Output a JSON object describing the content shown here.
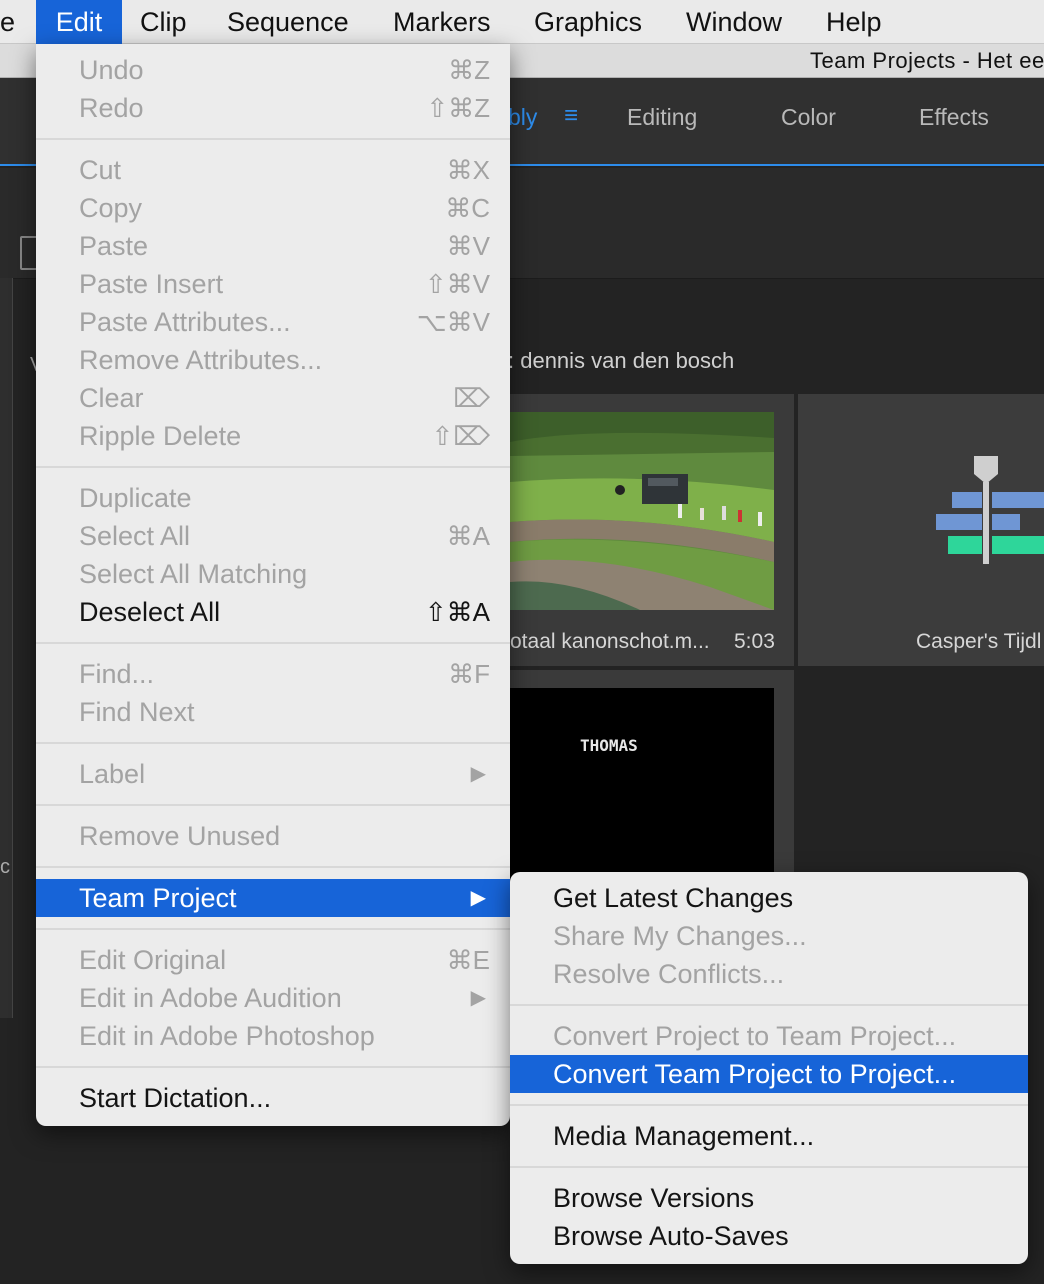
{
  "menubar": {
    "items": [
      {
        "label": "e"
      },
      {
        "label": "Edit"
      },
      {
        "label": "Clip"
      },
      {
        "label": "Sequence"
      },
      {
        "label": "Markers"
      },
      {
        "label": "Graphics"
      },
      {
        "label": "Window"
      },
      {
        "label": "Help"
      }
    ]
  },
  "window": {
    "title": "Team Projects - Het ee"
  },
  "workspaces": {
    "tabs": [
      {
        "label": "bly",
        "active": true
      },
      {
        "label": "Editing"
      },
      {
        "label": "Color"
      },
      {
        "label": "Effects"
      }
    ],
    "menu_glyph": "≡"
  },
  "project_panel": {
    "path_label": ": dennis van den bosch",
    "left_edge_chars": [
      "V",
      "c"
    ],
    "tiles": [
      {
        "name": "otaal kanonschot.m...",
        "duration": "5:03",
        "icon": "video-thumbnail"
      },
      {
        "name": "Casper's Tijdl",
        "icon": "sequence-icon"
      },
      {
        "caption": "THOMAS",
        "icon": "title-clip-thumbnail"
      }
    ]
  },
  "edit_menu": {
    "items": [
      {
        "label": "Undo",
        "shortcut": "⌘Z",
        "enabled": false
      },
      {
        "label": "Redo",
        "shortcut": "⇧⌘Z",
        "enabled": false
      },
      {
        "label": "Cut",
        "shortcut": "⌘X",
        "enabled": false
      },
      {
        "label": "Copy",
        "shortcut": "⌘C",
        "enabled": false
      },
      {
        "label": "Paste",
        "shortcut": "⌘V",
        "enabled": false
      },
      {
        "label": "Paste Insert",
        "shortcut": "⇧⌘V",
        "enabled": false
      },
      {
        "label": "Paste Attributes...",
        "shortcut": "⌥⌘V",
        "enabled": false
      },
      {
        "label": "Remove Attributes...",
        "shortcut": "",
        "enabled": false
      },
      {
        "label": "Clear",
        "shortcut": "⌦",
        "enabled": false
      },
      {
        "label": "Ripple Delete",
        "shortcut": "⇧⌦",
        "enabled": false
      },
      {
        "label": "Duplicate",
        "shortcut": "",
        "enabled": false
      },
      {
        "label": "Select All",
        "shortcut": "⌘A",
        "enabled": false
      },
      {
        "label": "Select All Matching",
        "shortcut": "",
        "enabled": false
      },
      {
        "label": "Deselect All",
        "shortcut": "⇧⌘A",
        "enabled": true
      },
      {
        "label": "Find...",
        "shortcut": "⌘F",
        "enabled": false
      },
      {
        "label": "Find Next",
        "shortcut": "",
        "enabled": false
      },
      {
        "label": "Label",
        "shortcut": "▶",
        "enabled": false
      },
      {
        "label": "Remove Unused",
        "shortcut": "",
        "enabled": false
      },
      {
        "label": "Team Project",
        "shortcut": "▶",
        "enabled": true,
        "highlighted": true
      },
      {
        "label": "Edit Original",
        "shortcut": "⌘E",
        "enabled": false
      },
      {
        "label": "Edit in Adobe Audition",
        "shortcut": "▶",
        "enabled": false
      },
      {
        "label": "Edit in Adobe Photoshop",
        "shortcut": "",
        "enabled": false
      },
      {
        "label": "Start Dictation...",
        "shortcut": "",
        "enabled": true
      }
    ]
  },
  "team_project_submenu": {
    "items": [
      {
        "label": "Get Latest Changes",
        "enabled": true
      },
      {
        "label": "Share My Changes...",
        "enabled": false
      },
      {
        "label": "Resolve Conflicts...",
        "enabled": false
      },
      {
        "label": "Convert Project to Team Project...",
        "enabled": false
      },
      {
        "label": "Convert Team Project to Project...",
        "enabled": true,
        "highlighted": true
      },
      {
        "label": "Media Management...",
        "enabled": true
      },
      {
        "label": "Browse Versions",
        "enabled": true
      },
      {
        "label": "Browse Auto-Saves",
        "enabled": true
      }
    ]
  },
  "colors": {
    "menu_highlight": "#1764d8",
    "accent_blue": "#2d8ceb",
    "menu_background": "#ececec",
    "disabled_text": "#a3a3a3",
    "app_background": "#232323"
  }
}
